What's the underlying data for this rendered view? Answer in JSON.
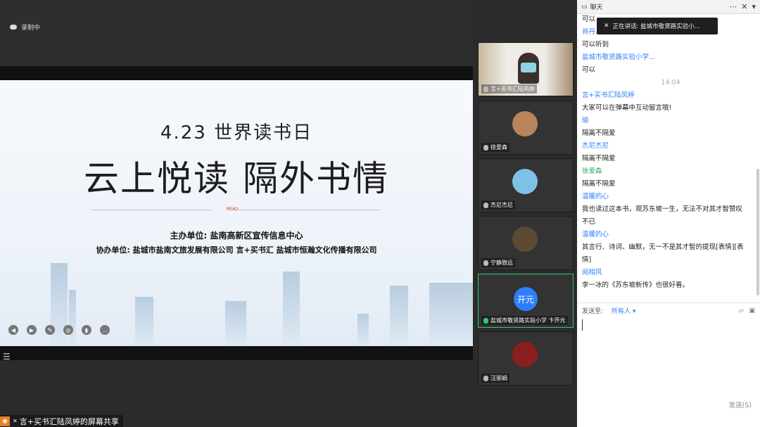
{
  "recording": {
    "label": "录制中"
  },
  "slide": {
    "date": "4.23 世界读书日",
    "title": "云上悦读  隔外书情",
    "read": "READ",
    "host": "主办单位: 盐南高新区宣传信息中心",
    "cohost": "协办单位: 盐城市盐南文旅发展有限公司   言+买书汇   盐城市恒瀚文化传播有限公司"
  },
  "share": {
    "label": "言+买书汇陆凤婷的屏幕共享"
  },
  "participants": [
    {
      "name": "言+买书汇陆凤婷"
    },
    {
      "name": "徐爱森"
    },
    {
      "name": "杰尼杰尼"
    },
    {
      "name": "宁静致远"
    },
    {
      "name": "盐城市敬贤路实验小学 卞开元",
      "avatar_text": "开元"
    },
    {
      "name": "汪丽娟"
    }
  ],
  "chat": {
    "title": "聊天",
    "tooltip": "正在讲话: 盐城市敬贤路实验小...",
    "messages": [
      {
        "type": "text",
        "text": "可以"
      },
      {
        "type": "sender",
        "text": "肖丹..."
      },
      {
        "type": "text",
        "text": "可以听到"
      },
      {
        "type": "sender",
        "text": "盐城市敬贤路实验小学..."
      },
      {
        "type": "text",
        "text": "可以"
      },
      {
        "type": "time",
        "text": "14:04"
      },
      {
        "type": "sender",
        "text": "言+买书汇陆凤婷"
      },
      {
        "type": "text",
        "text": "大家可以在弹幕中互动留言哦!"
      },
      {
        "type": "sender",
        "text": "瑜"
      },
      {
        "type": "text",
        "text": "隔离不隔爱"
      },
      {
        "type": "sender",
        "text": "杰尼杰尼"
      },
      {
        "type": "text",
        "text": "隔离不隔爱"
      },
      {
        "type": "sender-g",
        "text": "徐爱森"
      },
      {
        "type": "text",
        "text": "隔离不隔爱"
      },
      {
        "type": "sender",
        "text": "温暖的心"
      },
      {
        "type": "text",
        "text": "我也读过这本书，观苏东坡一生，无法不对其才智赞叹"
      },
      {
        "type": "text",
        "text": "不已"
      },
      {
        "type": "sender",
        "text": "温暖的心"
      },
      {
        "type": "text",
        "text": "其言行、诗词、幽默，无一不是其才智的提现[表情][表"
      },
      {
        "type": "text",
        "text": "情]"
      },
      {
        "type": "sender",
        "text": "阅相风"
      },
      {
        "type": "text",
        "text": "李一冰的《苏东坡新传》也很好看。"
      }
    ],
    "send_to_label": "发送至:",
    "send_to_value": "所有人",
    "send_button": "发送(S)"
  }
}
